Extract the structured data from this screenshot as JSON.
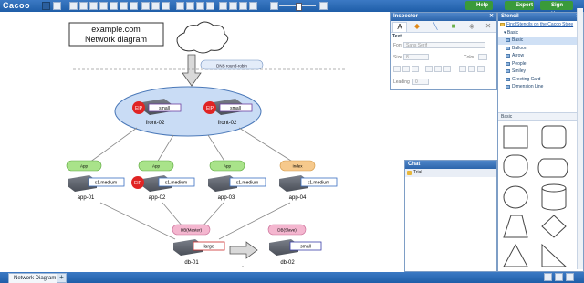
{
  "app": {
    "logo": "Cacoo"
  },
  "topbar": {
    "help": "Help",
    "export": "Export",
    "signup": "Sign Up"
  },
  "diagram": {
    "title_line1": "example.com",
    "title_line2": "Network diagram",
    "dns_label": "DNS round-robin",
    "front_nodes": [
      {
        "eip": "EIP",
        "size": "small",
        "name": "front-02"
      },
      {
        "eip": "EIP",
        "size": "small",
        "name": "front-02"
      }
    ],
    "app_nodes": [
      {
        "role": "App",
        "size": "c1.medium",
        "name": "app-01",
        "eip": ""
      },
      {
        "role": "App",
        "size": "c1.medium",
        "name": "app-02",
        "eip": "EIP"
      },
      {
        "role": "App",
        "size": "c1.medium",
        "name": "app-03",
        "eip": ""
      },
      {
        "role": "Index",
        "size": "c1.medium",
        "name": "app-04",
        "eip": ""
      }
    ],
    "db_nodes": [
      {
        "role": "DB(Master)",
        "size": "large",
        "name": "db-01"
      },
      {
        "role": "DB(Slave)",
        "size": "small",
        "name": "db-02"
      }
    ]
  },
  "inspector": {
    "title": "Inspector",
    "section": "Text",
    "font_label": "Font",
    "font_value": "Sans Serif",
    "size_label": "Size",
    "size_value": "8",
    "color_label": "Color",
    "leading_label": "Leading",
    "leading_value": "0"
  },
  "chat": {
    "title": "Chat",
    "item": "Trial"
  },
  "stencil": {
    "title": "Stencil",
    "find_link": "Find Stencils on the Cacoo Store",
    "group": "Basic",
    "items": [
      "Basic",
      "Balloon",
      "Arrow",
      "People",
      "Smiley",
      "Greeting Card",
      "Dimension Line"
    ],
    "shapes_title": "Basic"
  },
  "statusbar": {
    "page_tab": "Network Diagram",
    "add": "+"
  },
  "colors": {
    "accent": "#2c65ab",
    "eip": "#e02424",
    "app_pill": "#a9e38a",
    "index_pill": "#f6c98c",
    "db_pill": "#f4b6cf",
    "lb_fill": "#c9dcf5"
  }
}
